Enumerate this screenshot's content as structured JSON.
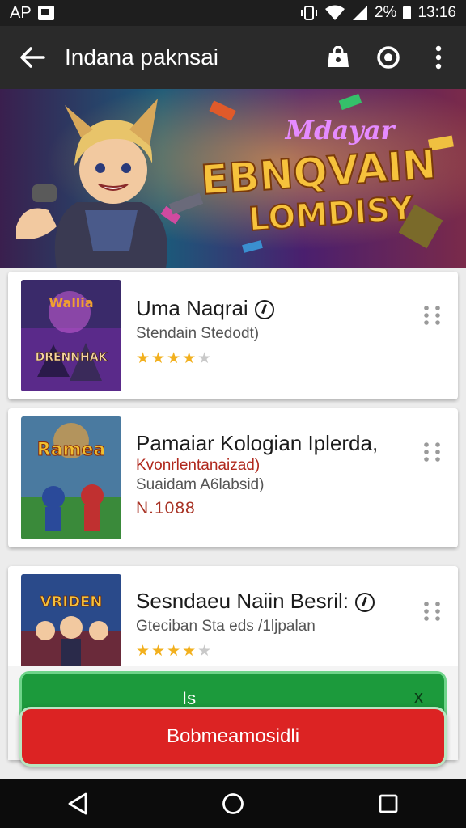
{
  "status_bar": {
    "carrier": "AP",
    "right_text": "2%",
    "time": "13:16"
  },
  "app_bar": {
    "title": "Indana paknsai"
  },
  "banner": {
    "script_title": "Mdayar",
    "headline_1": "EBNQVAIN",
    "headline_2": "LOMDISY"
  },
  "items": [
    {
      "title": "Uma Naqrai",
      "subtitle": "Stendain Stedodt)",
      "rating": 4,
      "thumb_text": "DRENNHAK",
      "thumb_top": "Wallia"
    },
    {
      "title": "Pamaiar Kologian Iplerda,",
      "subtitle_red": "Kvonrlentanaizad)",
      "subtitle": "Suaidam A6labsid)",
      "price": "N.1088",
      "thumb_text": "Ramea"
    },
    {
      "title": "Sesndaeu Naiin Besril:",
      "subtitle": "Gteciban Sta eds /1ljpalan",
      "rating": 4,
      "thumb_text": "VRIDEN"
    }
  ],
  "sheet": {
    "green_label": "Is",
    "green_close": "x",
    "red_label": "Bobmeamosidli"
  },
  "colors": {
    "app_bar": "#2a2a2a",
    "green_button": "#1c9a3c",
    "red_button": "#dc2323",
    "star": "#f2b01e"
  }
}
